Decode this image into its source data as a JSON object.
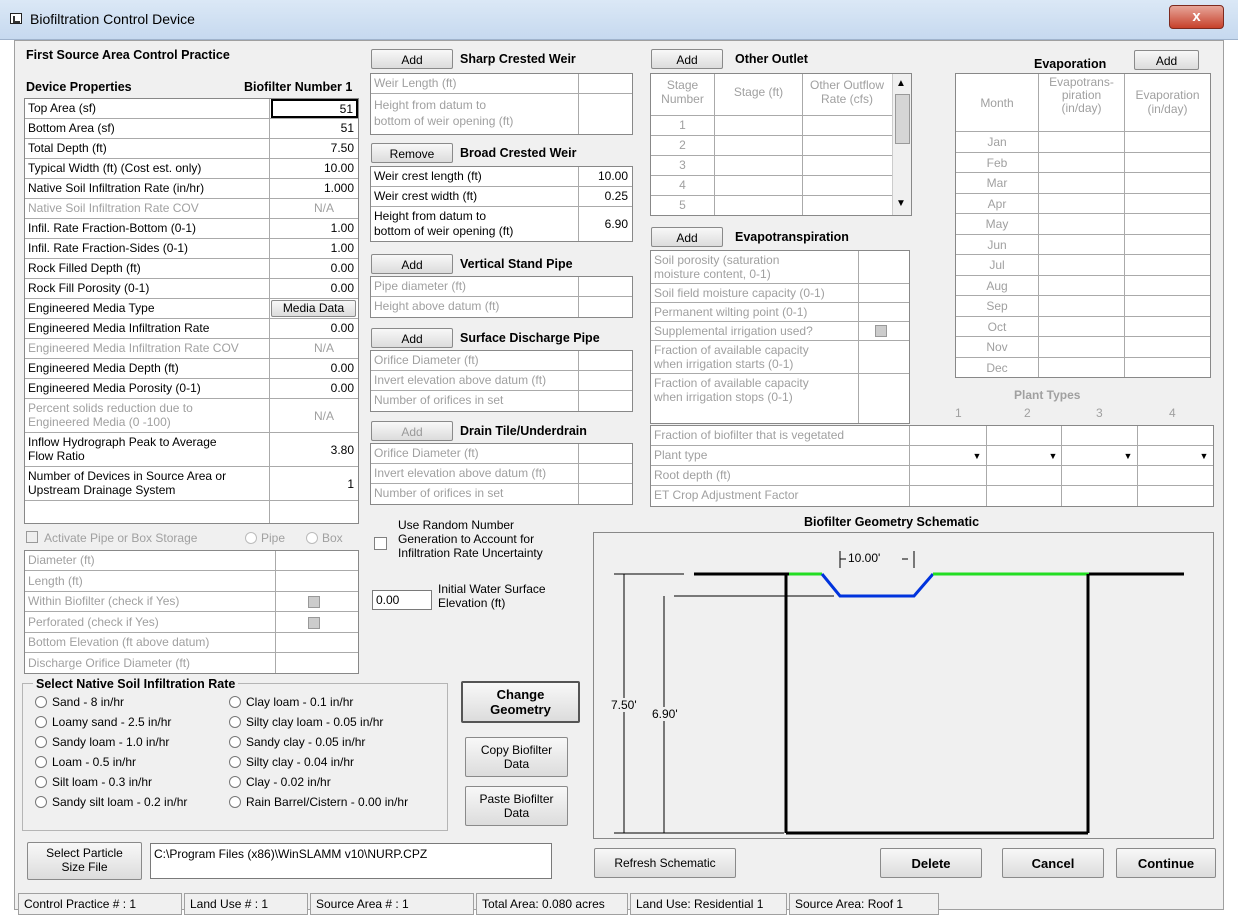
{
  "window": {
    "title": "Biofiltration Control Device",
    "close_label": "x"
  },
  "device": {
    "section_title": "First Source Area Control Practice",
    "props_header": "Device Properties",
    "number_label": "Biofilter Number 1",
    "rows": [
      {
        "label": "Top Area (sf)",
        "value": "51"
      },
      {
        "label": "Bottom Area (sf)",
        "value": "51"
      },
      {
        "label": "Total Depth (ft)",
        "value": "7.50"
      },
      {
        "label": "Typical Width (ft) (Cost est. only)",
        "value": "10.00"
      },
      {
        "label": "Native Soil Infiltration Rate (in/hr)",
        "value": "1.000"
      },
      {
        "label": "Native Soil Infiltration Rate COV",
        "value": "N/A"
      },
      {
        "label": "Infil. Rate Fraction-Bottom (0-1)",
        "value": "1.00"
      },
      {
        "label": "Infil. Rate Fraction-Sides (0-1)",
        "value": "1.00"
      },
      {
        "label": "Rock Filled Depth (ft)",
        "value": "0.00"
      },
      {
        "label": "Rock Fill Porosity (0-1)",
        "value": "0.00"
      },
      {
        "label": "Engineered Media Type",
        "value": "Media Data"
      },
      {
        "label": "Engineered Media Infiltration Rate",
        "value": "0.00"
      },
      {
        "label": "Engineered Media Infiltration Rate COV",
        "value": "N/A"
      },
      {
        "label": "Engineered Media Depth (ft)",
        "value": "0.00"
      },
      {
        "label": "Engineered Media Porosity (0-1)",
        "value": "0.00"
      },
      {
        "label": "Percent solids reduction due to",
        "label2": "Engineered Media (0 -100)",
        "value": "N/A"
      },
      {
        "label": "Inflow Hydrograph Peak to Average",
        "label2": "Flow Ratio",
        "value": "3.80"
      },
      {
        "label": "Number of Devices in Source Area or",
        "label2": "Upstream Drainage System",
        "value": "1"
      }
    ]
  },
  "storage": {
    "activate_label": "Activate Pipe or Box Storage",
    "pipe_label": "Pipe",
    "box_label": "Box",
    "rows": [
      "Diameter (ft)",
      "Length (ft)",
      "Within Biofilter (check if Yes)",
      "Perforated (check if Yes)",
      "Bottom Elevation (ft above datum)",
      "Discharge Orifice Diameter (ft)"
    ]
  },
  "soil": {
    "title": "Select Native Soil Infiltration Rate",
    "left": [
      "Sand - 8 in/hr",
      "Loamy sand - 2.5 in/hr",
      "Sandy loam - 1.0 in/hr",
      "Loam - 0.5 in/hr",
      "Silt loam - 0.3 in/hr",
      "Sandy silt loam - 0.2 in/hr"
    ],
    "right": [
      "Clay loam - 0.1 in/hr",
      "Silty clay loam - 0.05 in/hr",
      "Sandy clay - 0.05 in/hr",
      "Silty clay - 0.04 in/hr",
      "Clay - 0.02 in/hr",
      "Rain Barrel/Cistern - 0.00 in/hr"
    ]
  },
  "particle": {
    "button": "Select Particle",
    "button2": "Size File",
    "path": "C:\\Program Files (x86)\\WinSLAMM v10\\NURP.CPZ"
  },
  "sharp_weir": {
    "add": "Add",
    "title": "Sharp Crested Weir",
    "rows": [
      "Weir Length (ft)",
      "Height from datum to",
      "bottom of weir opening (ft)"
    ]
  },
  "broad_weir": {
    "remove": "Remove",
    "title": "Broad Crested Weir",
    "rows": [
      {
        "label": "Weir crest length (ft)",
        "value": "10.00"
      },
      {
        "label": "Weir crest width (ft)",
        "value": "0.25"
      },
      {
        "label": "Height from datum to",
        "label2": "bottom of weir opening (ft)",
        "value": "6.90"
      }
    ]
  },
  "stand_pipe": {
    "add": "Add",
    "title": "Vertical Stand Pipe",
    "rows": [
      "Pipe diameter (ft)",
      "Height above datum (ft)"
    ]
  },
  "surface_pipe": {
    "add": "Add",
    "title": "Surface Discharge Pipe",
    "rows": [
      "Orifice Diameter (ft)",
      "Invert elevation above datum (ft)",
      "Number of orifices in set"
    ]
  },
  "drain_tile": {
    "add": "Add",
    "title": "Drain Tile/Underdrain",
    "rows": [
      "Orifice Diameter (ft)",
      "Invert elevation above datum (ft)",
      "Number of orifices in set"
    ]
  },
  "random": {
    "label1": "Use Random Number",
    "label2": "Generation to Account for",
    "label3": "Infiltration Rate Uncertainty"
  },
  "water_surface": {
    "value": "0.00",
    "label1": "Initial Water Surface",
    "label2": "Elevation (ft)"
  },
  "buttons": {
    "change_geometry1": "Change",
    "change_geometry2": "Geometry",
    "copy1": "Copy Biofilter",
    "copy2": "Data",
    "paste1": "Paste Biofilter",
    "paste2": "Data",
    "refresh": "Refresh Schematic",
    "delete": "Delete",
    "cancel": "Cancel",
    "continue": "Continue"
  },
  "other_outlet": {
    "add": "Add",
    "title": "Other Outlet",
    "col1": "Stage",
    "col1b": "Number",
    "col2": "Stage (ft)",
    "col3": "Other Outflow",
    "col3b": "Rate (cfs)",
    "stages": [
      "1",
      "2",
      "3",
      "4",
      "5"
    ]
  },
  "evapotranspiration": {
    "add": "Add",
    "title": "Evapotranspiration",
    "rows": [
      [
        "Soil porosity (saturation",
        "moisture content, 0-1)"
      ],
      [
        "Soil field moisture capacity (0-1)"
      ],
      [
        "Permanent wilting point (0-1)"
      ],
      [
        "Supplemental irrigation used?"
      ],
      [
        "Fraction of available capacity",
        "when irrigation starts (0-1)"
      ],
      [
        "Fraction of available capacity",
        "when irrigation stops (0-1)"
      ]
    ]
  },
  "evaporation": {
    "title": "Evaporation",
    "add": "Add",
    "col_month": "Month",
    "col_et1": "Evapotrans-",
    "col_et2": "piration",
    "col_et3": "(in/day)",
    "col_ev1": "Evaporation",
    "col_ev2": "(in/day)",
    "months": [
      "Jan",
      "Feb",
      "Mar",
      "Apr",
      "May",
      "Jun",
      "Jul",
      "Aug",
      "Sep",
      "Oct",
      "Nov",
      "Dec"
    ]
  },
  "plants": {
    "title": "Plant Types",
    "cols": [
      "1",
      "2",
      "3",
      "4"
    ],
    "rows": [
      "Fraction of biofilter that is vegetated",
      "Plant type",
      "Root depth (ft)",
      "ET Crop Adjustment Factor"
    ]
  },
  "schematic": {
    "title": "Biofilter Geometry  Schematic",
    "width_label": "10.00'",
    "depth_label": "7.50'",
    "weir_label": "6.90'"
  },
  "status": [
    "Control Practice # :  1",
    "Land Use # :  1",
    "Source Area # :  1",
    "Total Area:  0.080 acres",
    "Land Use:  Residential 1",
    "Source Area:  Roof 1"
  ]
}
